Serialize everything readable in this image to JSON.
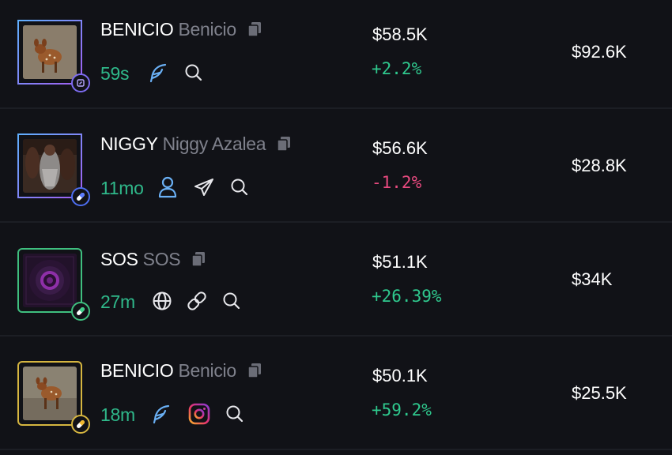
{
  "rows": [
    {
      "symbol": "BENICIO",
      "name": "Benicio",
      "age": "59s",
      "price": "$58.5K",
      "change": "+2.2%",
      "mcap": "$92.6K"
    },
    {
      "symbol": "NIGGY",
      "name": "Niggy Azalea",
      "age": "11mo",
      "price": "$56.6K",
      "change": "-1.2%",
      "mcap": "$28.8K"
    },
    {
      "symbol": "SOS",
      "name": "SOS",
      "age": "27m",
      "price": "$51.1K",
      "change": "+26.39%",
      "mcap": "$34K"
    },
    {
      "symbol": "BENICIO",
      "name": "Benicio",
      "age": "18m",
      "price": "$50.1K",
      "change": "+59.2%",
      "mcap": "$25.5K"
    }
  ],
  "icons": {
    "row0": [
      "feather-icon",
      "search-icon"
    ],
    "row1": [
      "user-icon",
      "telegram-icon",
      "search-icon"
    ],
    "row2": [
      "globe-icon",
      "link-icon",
      "search-icon"
    ],
    "row3": [
      "feather-icon",
      "instagram-icon",
      "search-icon"
    ]
  },
  "colors": {
    "positive": "#2fc98e",
    "negative": "#e84a7f",
    "age": "#2fb88a",
    "muted": "#7f818c",
    "background": "#111217"
  }
}
